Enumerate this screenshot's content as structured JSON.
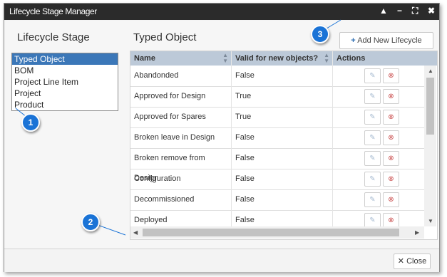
{
  "window": {
    "title": "Lifecycle Stage Manager",
    "controls": [
      "▲",
      "−",
      "⛶",
      "✖"
    ]
  },
  "left_panel": {
    "title": "Lifecycle Stage",
    "items": [
      "Typed Object",
      "BOM",
      "Project Line Item",
      "Project",
      "Product"
    ],
    "selected_index": 0
  },
  "right_panel": {
    "title": "Typed Object",
    "add_button_label": "Add New Lifecycle Stage...",
    "columns": [
      "Name",
      "Valid for new objects?",
      "Actions"
    ],
    "rows": [
      {
        "name": "Abandonded",
        "valid": "False"
      },
      {
        "name": "Approved for Design",
        "valid": "True"
      },
      {
        "name": "Approved for Spares",
        "valid": "True"
      },
      {
        "name": "Broken leave in Design",
        "valid": "False"
      },
      {
        "name": "Broken remove from Design",
        "valid": "False"
      },
      {
        "name": "Configuration",
        "valid": "False"
      },
      {
        "name": "Decommissioned",
        "valid": "False"
      },
      {
        "name": "Deployed",
        "valid": "False"
      }
    ]
  },
  "footer": {
    "close_label": "Close"
  },
  "callouts": [
    "1",
    "2",
    "3"
  ],
  "colors": {
    "titlebar": "#2b2b2b",
    "selection": "#3b77b8",
    "grid_header": "#bcc9d8",
    "callout": "#1a73d6"
  }
}
